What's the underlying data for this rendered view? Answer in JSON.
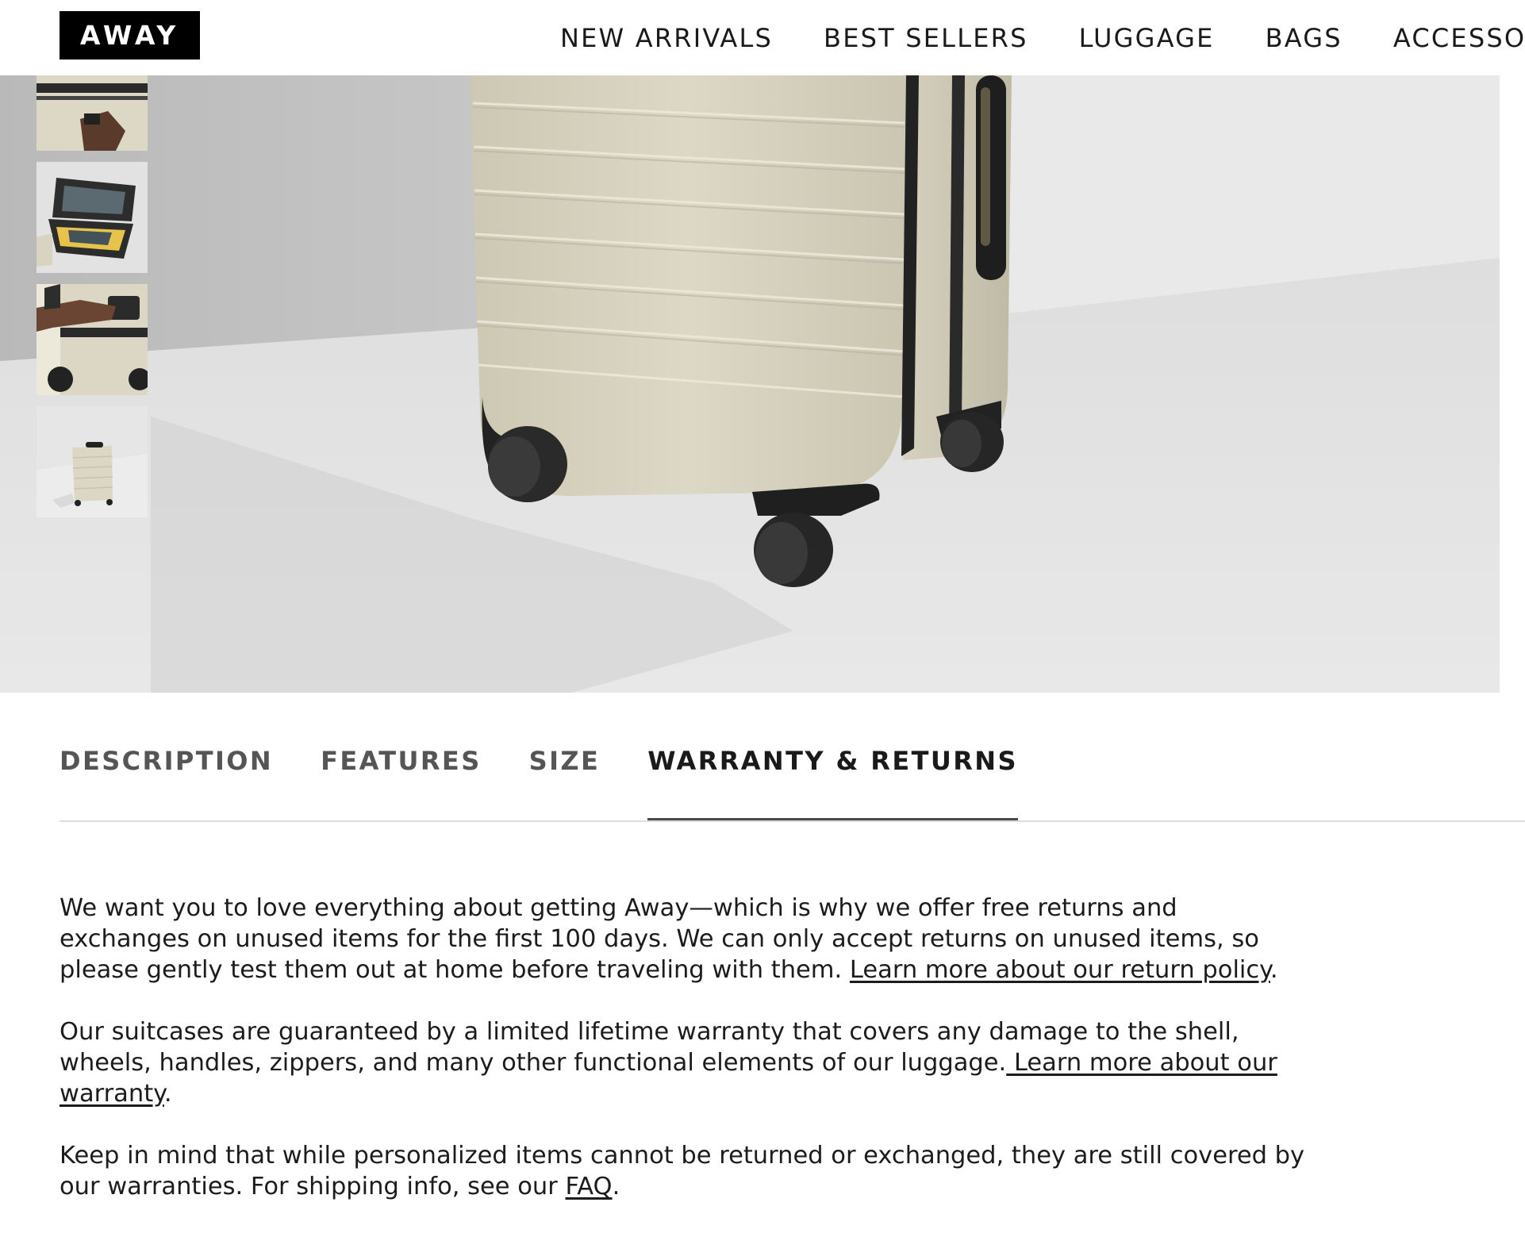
{
  "brand": {
    "logo_text": "AWAY"
  },
  "nav": {
    "items": [
      {
        "label": "NEW ARRIVALS"
      },
      {
        "label": "BEST SELLERS"
      },
      {
        "label": "LUGGAGE"
      },
      {
        "label": "BAGS"
      },
      {
        "label": "ACCESSORIES"
      }
    ]
  },
  "gallery": {
    "thumbnails": [
      {
        "subject": "suitcase handle closeup"
      },
      {
        "subject": "open suitcase interior"
      },
      {
        "subject": "hand on suitcase lock"
      },
      {
        "subject": "suitcase front view"
      }
    ]
  },
  "tabs": {
    "items": [
      {
        "label": "DESCRIPTION"
      },
      {
        "label": "FEATURES"
      },
      {
        "label": "SIZE"
      },
      {
        "label": "WARRANTY & RETURNS"
      }
    ],
    "active": "WARRANTY & RETURNS"
  },
  "warranty": {
    "p1_text": "We want you to love everything about getting Away—which is why we offer free returns and exchanges on unused items for the first 100 days. We can only accept returns on unused items, so please gently test them out at home before traveling with them. ",
    "p1_link": "Learn more about our return policy",
    "p1_end": ".",
    "p2_text": "Our suitcases are guaranteed by a limited lifetime warranty that covers any damage to the shell, wheels, handles, zippers, and many other functional elements of our luggage.",
    "p2_link": " Learn more about our warranty",
    "p2_end": ".",
    "p3_text": "Keep in mind that while personalized items cannot be returned or exchanged, they are still covered by our warranties. For shipping info, see our ",
    "p3_link": "FAQ",
    "p3_end": "."
  },
  "colors": {
    "text": "#1c1c1c",
    "suitcase": "#d8d4c2",
    "background": "#ffffff"
  }
}
